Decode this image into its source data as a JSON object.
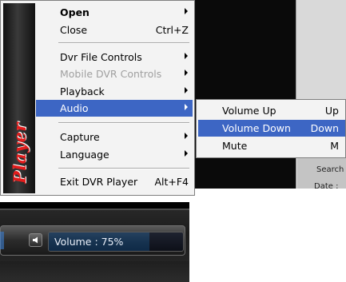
{
  "background": {
    "search_label": "Search",
    "date_label": "Date :"
  },
  "menu": {
    "logo_text": "Player",
    "items": [
      {
        "label": "Open",
        "shortcut": "",
        "submenu": true,
        "bold": true
      },
      {
        "label": "Close",
        "shortcut": "Ctrl+Z",
        "submenu": false
      },
      {
        "label": "Dvr File Controls",
        "shortcut": "",
        "submenu": true
      },
      {
        "label": "Mobile DVR Controls",
        "shortcut": "",
        "submenu": true,
        "disabled": true
      },
      {
        "label": "Playback",
        "shortcut": "",
        "submenu": true
      },
      {
        "label": "Audio",
        "shortcut": "",
        "submenu": true,
        "highlighted": true
      },
      {
        "label": "Capture",
        "shortcut": "",
        "submenu": true
      },
      {
        "label": "Language",
        "shortcut": "",
        "submenu": true
      },
      {
        "label": "Exit DVR Player",
        "shortcut": "Alt+F4",
        "submenu": false
      }
    ]
  },
  "audio_submenu": {
    "items": [
      {
        "label": "Volume Up",
        "shortcut": "Up"
      },
      {
        "label": "Volume Down",
        "shortcut": "Down",
        "highlighted": true
      },
      {
        "label": "Mute",
        "shortcut": "M"
      }
    ]
  },
  "player": {
    "volume_text": "Volume : 75%",
    "volume_level": 0.75,
    "icons": {
      "mute": "speaker-icon"
    }
  },
  "colors": {
    "highlight": "#3d66c4",
    "logo_red": "#e31b1b",
    "volume_fill": "#16324f"
  }
}
